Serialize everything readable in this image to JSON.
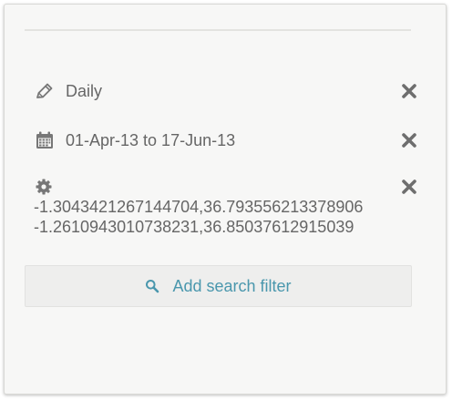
{
  "filters": {
    "frequency": {
      "icon": "pencil-icon",
      "label": "Daily"
    },
    "date_range": {
      "icon": "calendar-icon",
      "label": "01-Apr-13 to 17-Jun-13"
    },
    "location": {
      "icon": "gear-icon",
      "line1": "-1.3043421267144704,36.793556213378906",
      "line2": "-1.2610943010738231,36.85037612915039"
    }
  },
  "add_filter": {
    "icon": "search-icon",
    "label": "Add search filter"
  },
  "colors": {
    "text": "#666666",
    "accent": "#4a97ad",
    "panel_bg": "#f7f7f6",
    "button_bg": "#eeeeed"
  }
}
